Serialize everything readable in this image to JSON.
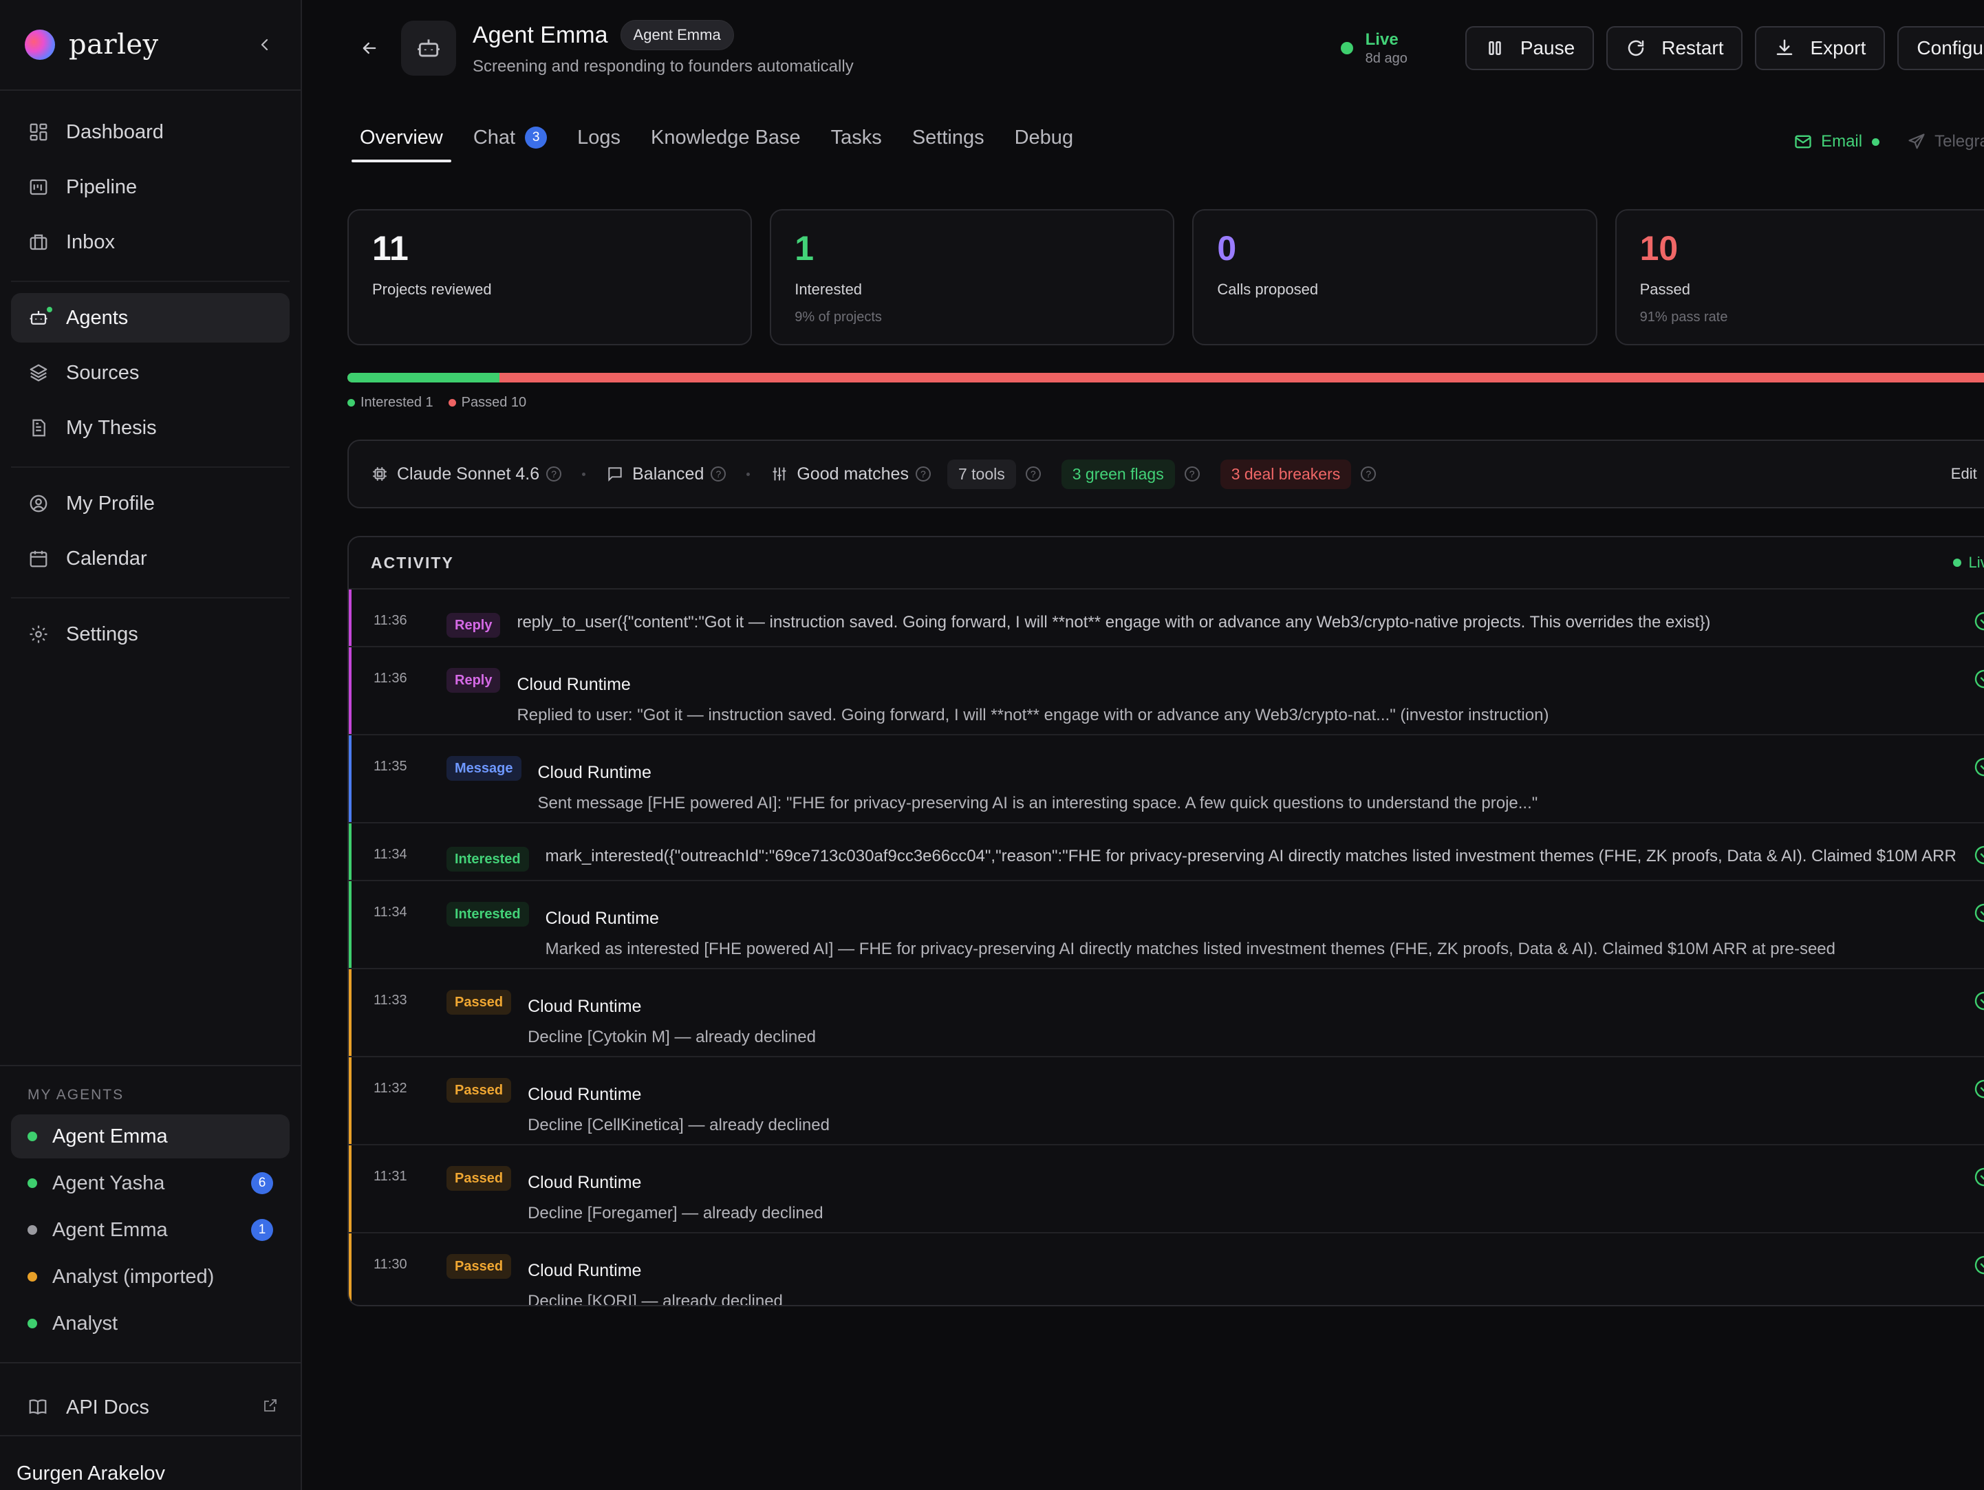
{
  "brand": {
    "name": "parley"
  },
  "sidebar": {
    "nav_primary": [
      {
        "label": "Dashboard",
        "icon": "dashboard-icon"
      },
      {
        "label": "Pipeline",
        "icon": "pipeline-icon"
      },
      {
        "label": "Inbox",
        "icon": "inbox-icon"
      }
    ],
    "nav_secondary": [
      {
        "label": "Agents",
        "icon": "robot-icon",
        "active": true
      },
      {
        "label": "Sources",
        "icon": "layers-icon"
      },
      {
        "label": "My Thesis",
        "icon": "document-icon"
      }
    ],
    "nav_tertiary": [
      {
        "label": "My Profile",
        "icon": "user-circle-icon"
      },
      {
        "label": "Calendar",
        "icon": "calendar-icon"
      }
    ],
    "settings": {
      "label": "Settings",
      "icon": "gear-icon"
    },
    "my_agents_label": "MY AGENTS",
    "my_agents": [
      {
        "name": "Agent Emma",
        "dot": "#3ecf6e",
        "count": "",
        "active": true
      },
      {
        "name": "Agent Yasha",
        "dot": "#3ecf6e",
        "count": "6"
      },
      {
        "name": "Agent Emma",
        "dot": "#9a9aa0",
        "count": "1"
      },
      {
        "name": "Analyst (imported)",
        "dot": "#e8a028",
        "count": ""
      },
      {
        "name": "Analyst",
        "dot": "#3ecf6e",
        "count": ""
      }
    ],
    "api_docs": "API Docs",
    "user": "Gurgen Arakelov"
  },
  "header": {
    "title": "Agent Emma",
    "badge": "Agent Emma",
    "subtitle": "Screening and responding to founders automatically",
    "live_label": "Live",
    "live_sub": "8d ago",
    "buttons": {
      "pause": "Pause",
      "restart": "Restart",
      "export": "Export",
      "configure": "Configure"
    }
  },
  "tabs": [
    {
      "label": "Overview",
      "active": true
    },
    {
      "label": "Chat",
      "count": "3"
    },
    {
      "label": "Logs"
    },
    {
      "label": "Knowledge Base"
    },
    {
      "label": "Tasks"
    },
    {
      "label": "Settings"
    },
    {
      "label": "Debug"
    }
  ],
  "channels": {
    "email": "Email",
    "telegram": "Telegram"
  },
  "stats": [
    {
      "value": "11",
      "label": "Projects reviewed",
      "sub": "",
      "color": "#f5f5f7"
    },
    {
      "value": "1",
      "label": "Interested",
      "sub": "9% of projects",
      "color": "#43d278"
    },
    {
      "value": "0",
      "label": "Calls proposed",
      "sub": "",
      "color": "#9a7cff"
    },
    {
      "value": "10",
      "label": "Passed",
      "sub": "91% pass rate",
      "color": "#f06767"
    }
  ],
  "progress": {
    "interested_fraction": 0.0909,
    "legend_interested": "Interested 1",
    "legend_passed": "Passed 10",
    "interested_color": "#3ecf6e",
    "passed_color": "#ee6363"
  },
  "config": {
    "model": "Claude Sonnet 4.6",
    "mode": "Balanced",
    "matching": "Good matches",
    "tools": "7 tools",
    "green_flags": "3 green flags",
    "deal_breakers": "3 deal breakers",
    "edit": "Edit →"
  },
  "activity": {
    "title": "ACTIVITY",
    "live": "Live",
    "rows": [
      {
        "time": "11:36",
        "type": "reply",
        "badge": "Reply",
        "layout": "single",
        "text": "reply_to_user({\"content\":\"Got it — instruction saved. Going forward, I will **not** engage with or advance any Web3/crypto-native projects. This overrides the exist})"
      },
      {
        "time": "11:36",
        "type": "reply",
        "badge": "Reply",
        "layout": "double",
        "source": "Cloud Runtime",
        "text": "Replied to user: \"Got it — instruction saved. Going forward, I will **not** engage with or advance any Web3/crypto-nat...\" (investor instruction)"
      },
      {
        "time": "11:35",
        "type": "message",
        "badge": "Message",
        "layout": "double",
        "source": "Cloud Runtime",
        "text": "Sent message [FHE powered AI]: \"FHE for privacy-preserving AI is an interesting space. A few quick questions to understand the proje...\""
      },
      {
        "time": "11:34",
        "type": "interested",
        "badge": "Interested",
        "layout": "single",
        "text": "mark_interested({\"outreachId\":\"69ce713c030af9cc3e66cc04\",\"reason\":\"FHE for privacy-preserving AI directly matches listed investment themes (FHE, ZK proofs, Data & AI). Claimed $10M ARR"
      },
      {
        "time": "11:34",
        "type": "interested",
        "badge": "Interested",
        "layout": "double",
        "source": "Cloud Runtime",
        "text": "Marked as interested [FHE powered AI] — FHE for privacy-preserving AI directly matches listed investment themes (FHE, ZK proofs, Data & AI). Claimed $10M ARR at pre-seed"
      },
      {
        "time": "11:33",
        "type": "passed",
        "badge": "Passed",
        "layout": "double",
        "source": "Cloud Runtime",
        "text": "Decline [Cytokin M] — already declined"
      },
      {
        "time": "11:32",
        "type": "passed",
        "badge": "Passed",
        "layout": "double",
        "source": "Cloud Runtime",
        "text": "Decline [CellKinetica] — already declined"
      },
      {
        "time": "11:31",
        "type": "passed",
        "badge": "Passed",
        "layout": "double",
        "source": "Cloud Runtime",
        "text": "Decline [Foregamer] — already declined"
      },
      {
        "time": "11:30",
        "type": "passed",
        "badge": "Passed",
        "layout": "double",
        "source": "Cloud Runtime",
        "text": "Decline [KORI] — already declined"
      }
    ]
  }
}
